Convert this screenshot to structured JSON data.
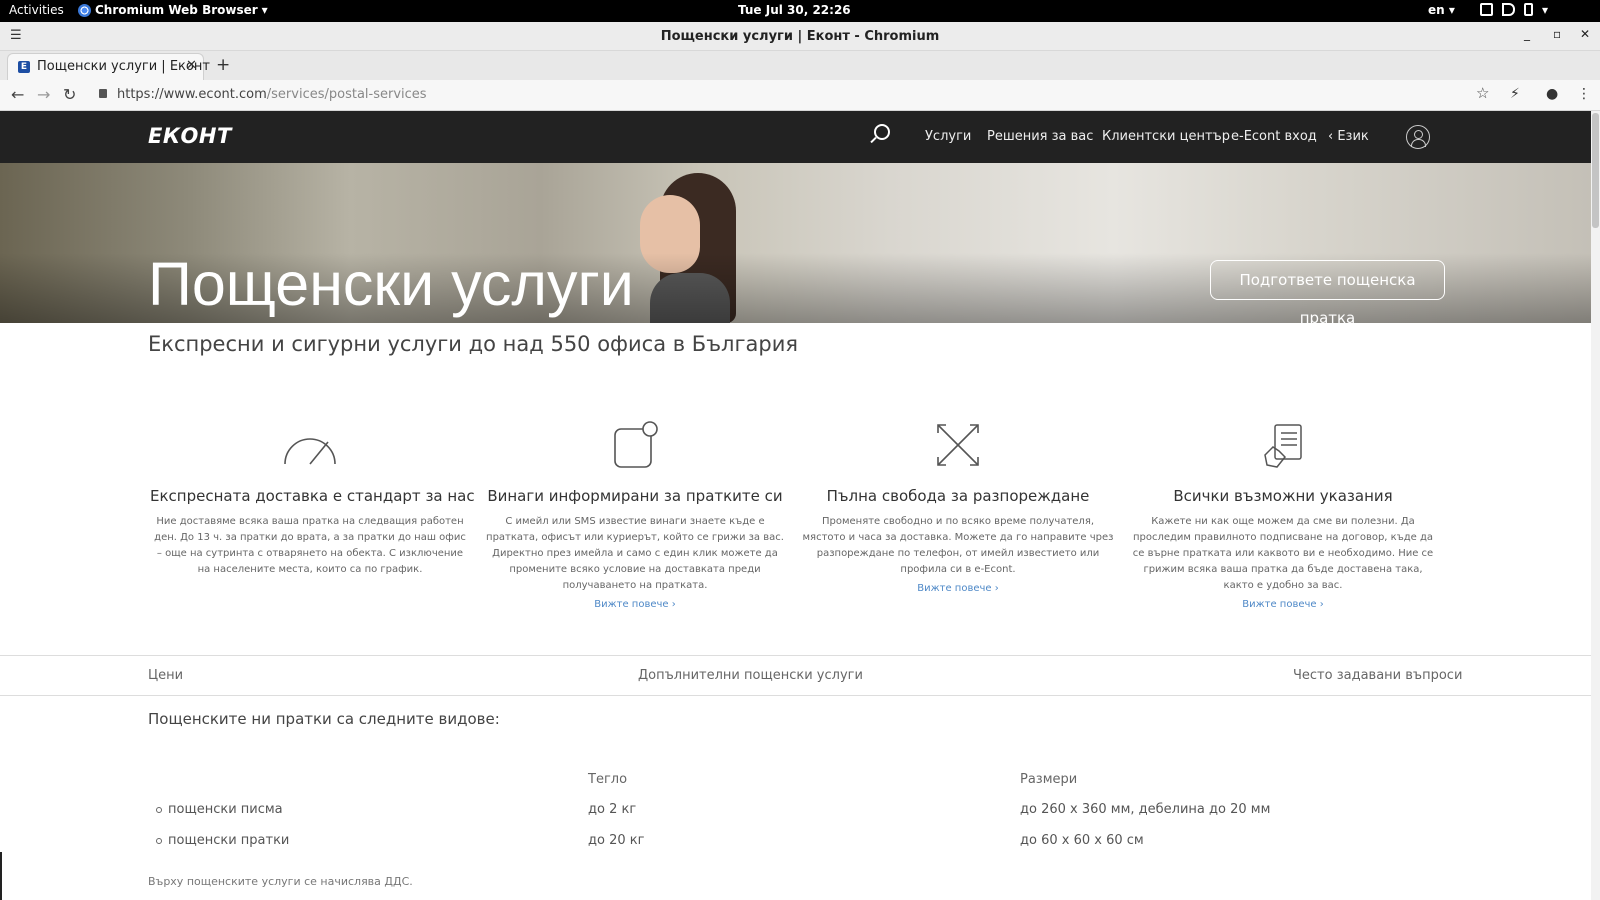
{
  "desktop": {
    "activities": "Activities",
    "app_name": "Chromium Web Browser",
    "clock": "Tue Jul 30, 22:26",
    "lang": "en"
  },
  "window": {
    "title": "Пощенски услуги | Еконт - Chromium"
  },
  "browser": {
    "tab_title": "Пощенски услуги | Еконт",
    "favicon_letter": "Е",
    "url_host": "https://www.econt.com",
    "url_path": "/services/postal-services"
  },
  "site": {
    "logo": "EКОНТ",
    "nav": [
      "Услуги",
      "Решения за вас",
      "Клиентски център",
      "e-Econt вход",
      "‹  Език"
    ],
    "hero_title": "Пощенски услуги",
    "hero_cta": "Подгответе пощенска пратка",
    "subtitle": "Експресни и сигурни услуги до над 550 офиса в България",
    "features": [
      {
        "icon": "speedometer-icon",
        "title": "Експресната доставка е стандарт за нас",
        "text": "Ние доставяме всяка ваша пратка на следващия работен ден. До 13 ч. за пратки до врата, а за пратки до наш офис – още на сутринта с отварянето на обекта. С изключение на населените места, които са по график.",
        "link": ""
      },
      {
        "icon": "notification-icon",
        "title": "Винаги информирани за пратките си",
        "text": "С имейл или SMS известие винаги знаете къде е пратката, офисът или куриерът, който се грижи за вас. Директно през имейла и само с един клик можете да промените всяко условие на доставката преди получаването на пратката.",
        "link": "Вижте повече ›"
      },
      {
        "icon": "expand-arrows-icon",
        "title": "Пълна свобода за разпореждане",
        "text": "Променяте свободно и по всяко време получателя, мястото и часа за доставка. Можете да го направите чрез разпореждане по телефон, от имейл известието или профила си в e-Econt.",
        "link": "Вижте повече ›"
      },
      {
        "icon": "hand-document-icon",
        "title": "Всички възможни указания",
        "text": "Кажете ни как още можем да сме ви полезни. Да проследим правилното подписване на договор, къде да се върне пратката или каквото ви е необходимо. Ние се грижим всяка ваша пратка да бъде доставена така, както е удобно за вас.",
        "link": "Вижте повече ›"
      }
    ],
    "subnav": [
      "Цени",
      "Допълнителни пощенски услуги",
      "Често задавани въпроси"
    ],
    "types_title": "Пощенските ни пратки са следните видове:",
    "table": {
      "headers": [
        "Тегло",
        "Размери"
      ],
      "rows": [
        {
          "type": "пощенски писма",
          "weight": "до 2 кг",
          "size": "до 260 х 360 мм, дебелина до 20 мм"
        },
        {
          "type": "пощенски пратки",
          "weight": "до 20 кг",
          "size": "до 60 х 60 х 60 см"
        }
      ]
    },
    "cutoff_text": "Върху пощенските услуги се начислява ДДС."
  }
}
